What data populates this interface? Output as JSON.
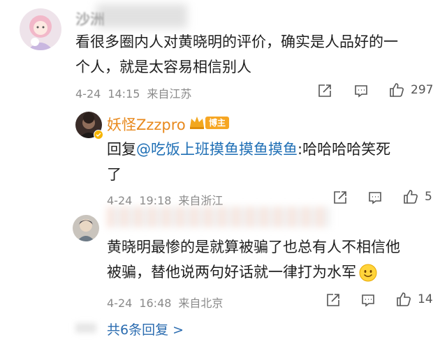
{
  "comment1": {
    "username": "沙洲",
    "text_line1": "看很多圈内人对黄晓明的评价，确实是人品好的一",
    "text_line2": "个人，就是太容易相信别人",
    "date": "4-24",
    "time": "14:15",
    "location": "来自江苏",
    "like_count": "297"
  },
  "reply1": {
    "author": "妖怪Zzzpro",
    "badge": "博主",
    "reply_prefix": "回复",
    "mention": "@吃饭上班摸鱼摸鱼摸鱼",
    "text_after_mention": ":哈哈哈哈笑死",
    "text_line2": "了",
    "date": "4-24",
    "time": "19:18",
    "location": "来自浙江",
    "like_count": "5"
  },
  "reply2": {
    "text_line1": "黄晓明最惨的是就算被骗了也总有人不相信他",
    "text_line2": "被骗，替他说两句好话就一律打为水军",
    "emoji": "smile-emoji",
    "date": "4-24",
    "time": "16:48",
    "location": "来自北京",
    "like_count": "14"
  },
  "footer": {
    "more_replies": "共6条回复 >"
  },
  "colors": {
    "author": "#e8891d",
    "link": "#1f6fb5",
    "meta": "#8a8a8a",
    "badge": "#f6a623"
  }
}
